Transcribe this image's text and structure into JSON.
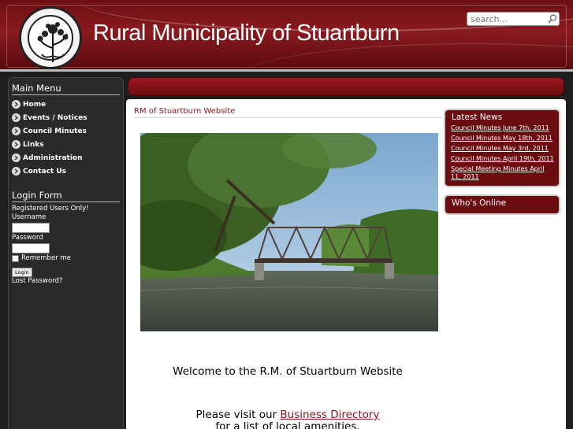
{
  "header": {
    "title": "Rural Municipality of Stuartburn",
    "search_placeholder": "search...",
    "logo_text": "RURAL MUNICIPALITY OF STUARTBURN · WESTERN PRAIRIE FRINGED ORCHID"
  },
  "main_menu": {
    "heading": "Main Menu",
    "items": [
      {
        "label": "Home"
      },
      {
        "label": "Events / Notices"
      },
      {
        "label": "Council Minutes"
      },
      {
        "label": "Links"
      },
      {
        "label": "Administration"
      },
      {
        "label": "Contact Us"
      }
    ]
  },
  "login": {
    "heading": "Login Form",
    "note": "Registered Users Only!",
    "username_label": "Username",
    "password_label": "Password",
    "remember_label": "Remember me",
    "button_label": "Login",
    "lost_password": "Lost Password?"
  },
  "content": {
    "heading": "RM of Stuartburn Website",
    "welcome": "Welcome to the R.M. of Stuartburn Website",
    "visit_prefix": "Please visit our ",
    "visit_link": "Business Directory",
    "visit_suffix": "for a list of local amenities."
  },
  "latest_news": {
    "title": "Latest News",
    "items": [
      {
        "label": "Council Minutes June 7th, 2011"
      },
      {
        "label": "Council Minutes May 18th, 2011"
      },
      {
        "label": "Council Minutes May 3rd, 2011"
      },
      {
        "label": "Council Minutes April 19th, 2011"
      },
      {
        "label": "Special Meeting Minutes April 11, 2011"
      }
    ]
  },
  "whos_online": {
    "title": "Who's Online"
  },
  "colors": {
    "brand_red": "#6a0c10",
    "link_red": "#8a1419"
  }
}
